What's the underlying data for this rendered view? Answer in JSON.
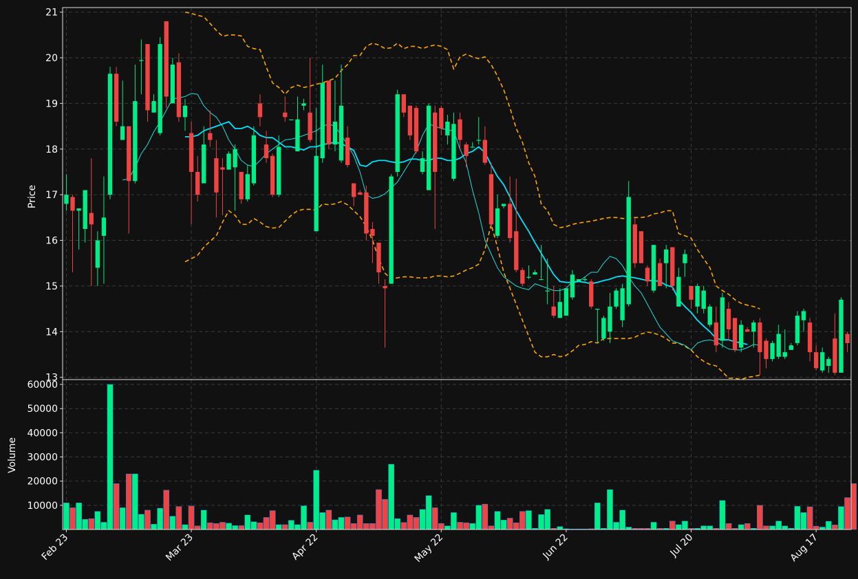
{
  "chart_data": {
    "type": "candlestick",
    "colors": {
      "background": "#111111",
      "up": "#00ee88",
      "down": "#ee4444",
      "grid": "#3a3a3a",
      "frame": "#e0e0e0",
      "text": "#ffffff",
      "bollinger": "#ffa500",
      "ma_fast": "#22dddd",
      "ma_slow": "#00e5ff"
    },
    "price_panel": {
      "ylabel": "Price",
      "ylim": [
        12.95,
        21.1
      ],
      "yticks": [
        13,
        14,
        15,
        16,
        17,
        18,
        19,
        20,
        21
      ]
    },
    "volume_panel": {
      "ylabel": "Volume",
      "ylim": [
        0,
        62000
      ],
      "yticks": [
        10000,
        20000,
        30000,
        40000,
        50000,
        60000
      ],
      "ytick_labels": [
        "10000",
        "20000",
        "30000",
        "40000",
        "50000",
        "60000"
      ]
    },
    "x_range": [
      -0.6,
      125.6
    ],
    "xticks": [
      {
        "index": 0,
        "label": "Feb 23"
      },
      {
        "index": 20,
        "label": "Mar 23"
      },
      {
        "index": 40,
        "label": "Apr 22"
      },
      {
        "index": 60,
        "label": "May 22"
      },
      {
        "index": 80,
        "label": "Jun 22"
      },
      {
        "index": 100,
        "label": "Jul 20"
      },
      {
        "index": 120,
        "label": "Aug 17"
      }
    ],
    "series": [
      {
        "name": "bb_upper",
        "start_index": 19,
        "values": [
          21.0,
          20.97,
          20.93,
          20.9,
          20.75,
          20.6,
          20.47,
          20.5,
          20.5,
          20.48,
          20.25,
          20.2,
          20.18,
          19.8,
          19.45,
          19.35,
          19.2,
          19.35,
          19.4,
          19.35,
          19.38,
          19.42,
          19.45,
          19.5,
          19.55,
          19.72,
          19.85,
          20.05,
          20.05,
          20.25,
          20.32,
          20.28,
          20.2,
          20.22,
          20.32,
          20.2,
          20.25,
          20.25,
          20.2,
          20.25,
          20.28,
          20.25,
          20.18,
          19.75,
          20.02,
          20.08,
          20.02,
          19.98,
          20.02,
          19.85,
          19.6,
          19.3,
          18.9,
          18.45,
          18.15,
          17.7,
          17.4,
          16.8,
          16.65,
          16.35,
          16.28,
          16.3,
          16.35,
          16.38,
          16.4,
          16.42,
          16.45,
          16.48,
          16.5,
          16.5,
          16.48,
          16.48,
          16.5,
          16.5,
          16.52,
          16.58,
          16.6,
          16.65,
          16.65,
          16.15,
          16.1,
          16.05,
          15.8,
          15.6,
          15.4,
          15.0,
          14.9,
          14.82,
          14.7,
          14.62,
          14.58,
          14.55,
          14.5
        ]
      },
      {
        "name": "bb_lower",
        "start_index": 19,
        "values": [
          15.53,
          15.6,
          15.67,
          15.85,
          15.98,
          16.1,
          16.4,
          16.65,
          16.55,
          16.35,
          16.35,
          16.48,
          16.4,
          16.3,
          16.27,
          16.28,
          16.42,
          16.55,
          16.65,
          16.68,
          16.68,
          16.66,
          16.8,
          16.78,
          16.8,
          16.85,
          16.78,
          16.65,
          16.52,
          16.3,
          16.0,
          15.6,
          15.28,
          15.15,
          15.18,
          15.2,
          15.2,
          15.18,
          15.18,
          15.18,
          15.22,
          15.22,
          15.2,
          15.22,
          15.28,
          15.35,
          15.4,
          15.48,
          15.8,
          16.35,
          15.85,
          15.3,
          14.95,
          14.6,
          14.25,
          13.9,
          13.55,
          13.45,
          13.45,
          13.5,
          13.45,
          13.48,
          13.58,
          13.7,
          13.72,
          13.78,
          13.75,
          13.85,
          13.85,
          13.85,
          13.85,
          13.85,
          13.88,
          13.95,
          13.99,
          13.97,
          13.92,
          13.85,
          13.75,
          13.75,
          13.68,
          13.6,
          13.45,
          13.35,
          13.28,
          13.25,
          13.12,
          12.98,
          12.98,
          12.95,
          13.0,
          13.02,
          13.05
        ]
      },
      {
        "name": "ma_fast",
        "start_index": 9,
        "values": [
          17.32,
          17.35,
          17.6,
          17.9,
          18.1,
          18.38,
          18.6,
          18.85,
          19.1,
          19.12,
          19.15,
          19.22,
          19.2,
          18.95,
          18.8,
          18.7,
          18.5,
          18.2,
          18.0,
          17.75,
          17.65,
          17.62,
          17.75,
          17.9,
          18.0,
          18.1,
          18.2,
          18.22,
          18.25,
          18.3,
          18.35,
          18.4,
          18.5,
          18.55,
          18.5,
          18.3,
          18.1,
          17.85,
          17.5,
          17.0,
          16.92,
          16.95,
          17.02,
          17.15,
          17.28,
          17.5,
          17.72,
          17.95,
          18.3,
          18.55,
          18.5,
          18.45,
          18.42,
          18.4,
          18.0,
          17.7,
          17.1,
          16.6,
          16.0,
          15.7,
          15.4,
          15.2,
          15.1,
          15.0,
          14.95,
          14.92,
          15.05,
          15.0,
          14.95,
          14.9,
          14.9,
          14.95,
          15.1,
          15.1,
          15.2,
          15.3,
          15.3,
          15.5,
          15.65,
          15.6,
          15.45,
          15.2,
          15.0,
          14.85,
          14.6,
          14.35,
          14.1,
          13.95,
          13.8,
          13.75,
          13.7,
          13.6,
          13.75,
          13.8,
          13.82,
          13.78,
          13.7,
          13.62,
          13.6,
          13.6,
          13.65,
          13.72,
          13.7
        ]
      },
      {
        "name": "ma_slow",
        "start_index": 19,
        "values": [
          18.27,
          18.27,
          18.3,
          18.4,
          18.45,
          18.5,
          18.55,
          18.6,
          18.45,
          18.45,
          18.5,
          18.42,
          18.3,
          18.25,
          18.25,
          18.15,
          18.05,
          18.05,
          18.02,
          17.98,
          18.05,
          18.05,
          18.1,
          18.12,
          18.15,
          18.12,
          18.05,
          17.97,
          17.65,
          17.62,
          17.72,
          17.75,
          17.75,
          17.72,
          17.7,
          17.72,
          17.78,
          17.78,
          17.75,
          17.75,
          17.8,
          17.8,
          17.75,
          17.75,
          17.8,
          17.9,
          17.95,
          18.05,
          17.92,
          17.65,
          17.4,
          17.22,
          16.95,
          16.65,
          16.42,
          16.2,
          15.95,
          15.72,
          15.48,
          15.25,
          15.1,
          15.08,
          15.08,
          15.1,
          15.08,
          15.05,
          15.08,
          15.12,
          15.15,
          15.2,
          15.22,
          15.2,
          15.18,
          15.15,
          15.12,
          15.12,
          15.1,
          15.02,
          14.98,
          14.7,
          14.55,
          14.42,
          14.25,
          14.12,
          14.0,
          13.85,
          13.82,
          13.82,
          13.78,
          13.75,
          13.72
        ]
      }
    ],
    "candles": [
      [
        16.8,
        17.0,
        16.65,
        17.45
      ],
      [
        16.95,
        16.65,
        15.3,
        17.0
      ],
      [
        16.65,
        16.7,
        15.8,
        16.7
      ],
      [
        16.25,
        17.1,
        15.95,
        17.1
      ],
      [
        16.6,
        16.35,
        15.0,
        17.8
      ],
      [
        15.4,
        16.0,
        15.0,
        16.2
      ],
      [
        16.1,
        16.5,
        15.05,
        17.4
      ],
      [
        17.0,
        19.65,
        16.9,
        19.8
      ],
      [
        19.65,
        18.6,
        18.5,
        19.8
      ],
      [
        18.2,
        18.5,
        18.2,
        19.5
      ],
      [
        18.5,
        17.3,
        16.15,
        18.5
      ],
      [
        17.3,
        19.05,
        17.25,
        19.85
      ],
      [
        19.95,
        19.95,
        19.2,
        20.4
      ],
      [
        20.3,
        18.85,
        18.6,
        20.3
      ],
      [
        18.8,
        19.05,
        18.8,
        19.2
      ],
      [
        18.35,
        20.3,
        18.3,
        20.45
      ],
      [
        20.8,
        19.15,
        18.9,
        20.8
      ],
      [
        19.0,
        19.85,
        19.6,
        20.0
      ],
      [
        19.9,
        18.7,
        18.6,
        20.1
      ],
      [
        18.7,
        18.95,
        18.4,
        19.1
      ],
      [
        18.35,
        17.5,
        16.35,
        18.6
      ],
      [
        17.5,
        17.0,
        16.85,
        17.85
      ],
      [
        17.25,
        18.1,
        17.25,
        18.5
      ],
      [
        18.35,
        18.2,
        18.05,
        18.85
      ],
      [
        17.8,
        17.05,
        16.5,
        18.2
      ],
      [
        17.6,
        17.55,
        16.55,
        17.8
      ],
      [
        17.55,
        17.9,
        17.55,
        17.95
      ],
      [
        17.6,
        18.0,
        16.65,
        18.1
      ],
      [
        17.5,
        16.9,
        16.8,
        17.5
      ],
      [
        16.9,
        17.45,
        16.85,
        17.65
      ],
      [
        17.25,
        18.3,
        17.2,
        18.5
      ],
      [
        19.0,
        18.7,
        18.5,
        19.2
      ],
      [
        18.1,
        17.8,
        17.7,
        18.4
      ],
      [
        17.85,
        17.0,
        16.95,
        17.9
      ],
      [
        17.0,
        18.05,
        16.95,
        18.3
      ],
      [
        18.8,
        18.7,
        18.6,
        19.15
      ],
      [
        18.65,
        18.65,
        18.65,
        18.65
      ],
      [
        17.95,
        18.65,
        18.0,
        19.15
      ],
      [
        18.95,
        19.0,
        18.85,
        19.1
      ],
      [
        18.8,
        18.2,
        18.15,
        20.0
      ],
      [
        16.2,
        17.85,
        16.2,
        18.9
      ],
      [
        17.8,
        19.45,
        17.7,
        19.85
      ],
      [
        19.5,
        18.1,
        18.0,
        19.5
      ],
      [
        18.1,
        18.6,
        17.95,
        19.5
      ],
      [
        17.75,
        18.95,
        17.7,
        19.85
      ],
      [
        18.25,
        17.65,
        17.6,
        18.5
      ],
      [
        17.25,
        16.95,
        16.75,
        17.25
      ],
      [
        17.05,
        17.0,
        17.0,
        17.1
      ],
      [
        17.05,
        16.15,
        16.0,
        17.2
      ],
      [
        16.25,
        16.1,
        15.5,
        16.4
      ],
      [
        15.95,
        15.3,
        15.05,
        15.95
      ],
      [
        15.0,
        14.95,
        13.65,
        15.15
      ],
      [
        15.05,
        17.4,
        15.05,
        17.45
      ],
      [
        17.5,
        19.2,
        17.4,
        19.3
      ],
      [
        19.2,
        18.8,
        18.7,
        19.2
      ],
      [
        18.95,
        18.3,
        18.2,
        18.95
      ],
      [
        18.9,
        17.95,
        17.9,
        18.95
      ],
      [
        17.5,
        17.8,
        17.45,
        17.95
      ],
      [
        17.1,
        18.95,
        17.1,
        19.0
      ],
      [
        18.8,
        17.5,
        16.25,
        18.95
      ],
      [
        18.9,
        18.45,
        18.3,
        18.95
      ],
      [
        18.3,
        18.6,
        18.1,
        18.75
      ],
      [
        17.35,
        18.55,
        17.3,
        18.8
      ],
      [
        18.65,
        18.2,
        18.0,
        18.8
      ],
      [
        18.1,
        17.85,
        17.6,
        18.15
      ],
      [
        18.05,
        18.05,
        18.05,
        18.15
      ],
      [
        18.2,
        18.2,
        18.1,
        18.7
      ],
      [
        18.2,
        17.7,
        17.65,
        18.5
      ],
      [
        17.45,
        16.35,
        16.25,
        17.7
      ],
      [
        16.1,
        16.7,
        16.05,
        17.0
      ],
      [
        16.75,
        16.8,
        16.7,
        16.8
      ],
      [
        16.8,
        16.05,
        15.95,
        17.4
      ],
      [
        16.2,
        15.35,
        15.3,
        17.35
      ],
      [
        15.35,
        15.05,
        15.0,
        15.4
      ],
      [
        15.2,
        15.2,
        15.15,
        15.45
      ],
      [
        15.25,
        15.3,
        15.25,
        15.35
      ],
      [
        15.15,
        15.15,
        15.15,
        15.9
      ],
      [
        14.9,
        14.9,
        14.6,
        15.6
      ],
      [
        14.55,
        14.35,
        14.3,
        15.0
      ],
      [
        14.3,
        14.65,
        14.3,
        14.95
      ],
      [
        14.35,
        14.95,
        14.35,
        14.95
      ],
      [
        14.75,
        15.25,
        14.7,
        15.35
      ],
      [
        15.1,
        15.15,
        15.1,
        15.15
      ],
      [
        15.15,
        15.15,
        15.1,
        15.2
      ],
      [
        15.1,
        14.55,
        14.5,
        15.15
      ],
      [
        14.5,
        14.5,
        13.75,
        14.5
      ],
      [
        13.85,
        14.3,
        13.8,
        14.35
      ],
      [
        14.0,
        14.55,
        13.75,
        14.85
      ],
      [
        14.55,
        14.9,
        14.5,
        14.95
      ],
      [
        14.25,
        14.95,
        14.1,
        15.05
      ],
      [
        14.6,
        16.95,
        14.55,
        17.3
      ],
      [
        16.35,
        15.5,
        15.4,
        16.5
      ],
      [
        16.2,
        15.5,
        15.5,
        16.2
      ],
      [
        15.4,
        15.1,
        15.0,
        15.45
      ],
      [
        14.9,
        15.9,
        14.85,
        15.9
      ],
      [
        15.5,
        15.0,
        15.0,
        15.6
      ],
      [
        15.5,
        15.8,
        14.95,
        15.9
      ],
      [
        15.85,
        15.0,
        14.9,
        15.85
      ],
      [
        14.55,
        15.2,
        14.55,
        15.4
      ],
      [
        15.5,
        15.7,
        15.2,
        15.8
      ],
      [
        15.0,
        14.7,
        14.5,
        15.0
      ],
      [
        14.55,
        15.0,
        14.4,
        15.05
      ],
      [
        14.5,
        14.9,
        14.4,
        15.0
      ],
      [
        14.15,
        14.55,
        14.1,
        14.6
      ],
      [
        14.2,
        13.7,
        13.55,
        14.55
      ],
      [
        13.8,
        14.75,
        13.65,
        14.85
      ],
      [
        14.5,
        14.05,
        13.8,
        14.65
      ],
      [
        14.3,
        13.6,
        13.55,
        14.3
      ],
      [
        13.65,
        14.15,
        13.55,
        14.25
      ],
      [
        14.05,
        14.0,
        14.0,
        14.1
      ],
      [
        14.0,
        14.2,
        13.65,
        14.25
      ],
      [
        14.2,
        13.55,
        13.05,
        14.3
      ],
      [
        13.8,
        13.4,
        13.2,
        13.85
      ],
      [
        13.4,
        13.75,
        13.35,
        13.8
      ],
      [
        13.45,
        13.95,
        13.4,
        14.15
      ],
      [
        13.45,
        13.55,
        13.4,
        14.05
      ],
      [
        13.6,
        13.7,
        13.6,
        13.75
      ],
      [
        13.75,
        14.35,
        13.7,
        14.45
      ],
      [
        14.25,
        14.45,
        14.0,
        14.5
      ],
      [
        14.2,
        13.55,
        13.35,
        14.3
      ],
      [
        13.55,
        13.2,
        13.15,
        13.7
      ],
      [
        13.15,
        13.55,
        13.1,
        13.65
      ],
      [
        13.25,
        13.4,
        13.1,
        13.45
      ],
      [
        13.85,
        13.1,
        13.05,
        14.4
      ],
      [
        13.1,
        14.7,
        13.1,
        14.75
      ],
      [
        13.95,
        13.75,
        13.55,
        14.0
      ]
    ],
    "volumes": [
      11000,
      9000,
      11000,
      4200,
      4500,
      7500,
      3000,
      60000,
      19000,
      9000,
      23000,
      23000,
      6300,
      8000,
      2200,
      8800,
      16300,
      5500,
      9500,
      2000,
      9700,
      1500,
      8000,
      2800,
      2500,
      3000,
      2600,
      1600,
      1600,
      6000,
      3200,
      2800,
      5000,
      7800,
      2000,
      2000,
      3800,
      2000,
      9800,
      3000,
      24500,
      7000,
      8000,
      4000,
      5000,
      5200,
      2500,
      6000,
      2500,
      2500,
      16500,
      12500,
      27000,
      4500,
      2900,
      6000,
      5000,
      8300,
      14000,
      9000,
      2500,
      1500,
      7000,
      3000,
      2800,
      2500,
      10000,
      10500,
      1500,
      7500,
      3900,
      4700,
      2800,
      7500,
      7800,
      500,
      6200,
      8300,
      500,
      1200,
      300,
      200,
      200,
      200,
      300,
      11000,
      500,
      16500,
      3000,
      8000,
      1000,
      500,
      500,
      500,
      3000,
      500,
      500,
      3500,
      2000,
      3500,
      500,
      500,
      1500,
      1500,
      500,
      12000,
      2500,
      500,
      2000,
      2500,
      500,
      10000,
      1500,
      1500,
      3500,
      1500,
      500,
      9600,
      7000,
      9400,
      1400,
      1000,
      3400,
      1900,
      9500,
      13200,
      19000
    ]
  }
}
